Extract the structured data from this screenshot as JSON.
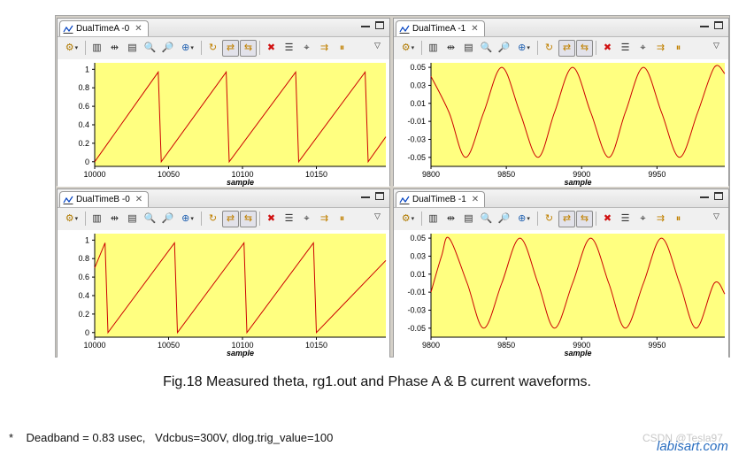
{
  "panels": [
    {
      "tab_label": "DualTimeA -0",
      "chart_data": {
        "type": "line",
        "xlabel": "sample",
        "ylabel": "",
        "xlim": [
          10000,
          10197
        ],
        "ylim": [
          -0.05,
          1.07
        ],
        "x_ticks": [
          10000,
          10050,
          10100,
          10150
        ],
        "y_ticks": [
          0,
          0.2,
          0.4,
          0.6,
          0.8,
          1
        ],
        "y_tick_labels": [
          "0",
          "0.2",
          "0.4",
          "0.6",
          "0.8",
          "1"
        ],
        "series": [
          {
            "color": "#cc0000",
            "points": [
              [
                10000,
                0.0
              ],
              [
                10043,
                0.97
              ],
              [
                10045,
                0.0
              ],
              [
                10089,
                0.97
              ],
              [
                10091,
                0.0
              ],
              [
                10136,
                0.97
              ],
              [
                10138,
                0.0
              ],
              [
                10183,
                0.97
              ],
              [
                10185,
                0.0
              ],
              [
                10197,
                0.27
              ]
            ]
          }
        ]
      }
    },
    {
      "tab_label": "DualTimeA -1",
      "chart_data": {
        "type": "line",
        "xlabel": "sample",
        "ylabel": "",
        "xlim": [
          9800,
          9995
        ],
        "ylim": [
          -0.06,
          0.055
        ],
        "x_ticks": [
          9800,
          9850,
          9900,
          9950
        ],
        "y_ticks": [
          -0.05,
          -0.03,
          -0.01,
          0.01,
          0.03,
          0.05
        ],
        "y_tick_labels": [
          "-0.05",
          "-0.03",
          "-0.01",
          "0.01",
          "0.03",
          "0.05"
        ],
        "series": [
          {
            "color": "#cc0000",
            "points": [
              [
                9800,
                0.04
              ],
              [
                9812,
                0.0
              ],
              [
                9823,
                -0.05
              ],
              [
                9835,
                0.0
              ],
              [
                9847,
                0.05
              ],
              [
                9859,
                0.0
              ],
              [
                9871,
                -0.05
              ],
              [
                9882,
                0.0
              ],
              [
                9894,
                0.05
              ],
              [
                9906,
                0.0
              ],
              [
                9918,
                -0.05
              ],
              [
                9929,
                0.0
              ],
              [
                9941,
                0.05
              ],
              [
                9953,
                0.0
              ],
              [
                9965,
                -0.05
              ],
              [
                9977,
                0.0
              ],
              [
                9988,
                0.05
              ],
              [
                9995,
                0.043
              ]
            ]
          }
        ]
      }
    },
    {
      "tab_label": "DualTimeB -0",
      "chart_data": {
        "type": "line",
        "xlabel": "sample",
        "ylabel": "",
        "xlim": [
          10000,
          10197
        ],
        "ylim": [
          -0.05,
          1.07
        ],
        "x_ticks": [
          10000,
          10050,
          10100,
          10150
        ],
        "y_ticks": [
          0,
          0.2,
          0.4,
          0.6,
          0.8,
          1
        ],
        "y_tick_labels": [
          "0",
          "0.2",
          "0.4",
          "0.6",
          "0.8",
          "1"
        ],
        "series": [
          {
            "color": "#cc0000",
            "points": [
              [
                10000,
                0.7
              ],
              [
                10007,
                0.97
              ],
              [
                10009,
                0.0
              ],
              [
                10054,
                0.97
              ],
              [
                10056,
                0.0
              ],
              [
                10101,
                0.97
              ],
              [
                10103,
                0.0
              ],
              [
                10148,
                0.97
              ],
              [
                10150,
                0.0
              ],
              [
                10197,
                0.78
              ]
            ]
          }
        ]
      }
    },
    {
      "tab_label": "DualTimeB -1",
      "chart_data": {
        "type": "line",
        "xlabel": "sample",
        "ylabel": "",
        "xlim": [
          9800,
          9995
        ],
        "ylim": [
          -0.06,
          0.055
        ],
        "x_ticks": [
          9800,
          9850,
          9900,
          9950
        ],
        "y_ticks": [
          -0.05,
          -0.03,
          -0.01,
          0.01,
          0.03,
          0.05
        ],
        "y_tick_labels": [
          "-0.05",
          "-0.03",
          "-0.01",
          "0.01",
          "0.03",
          "0.05"
        ],
        "series": [
          {
            "color": "#cc0000",
            "points": [
              [
                9800,
                -0.01
              ],
              [
                9807,
                0.03
              ],
              [
                9812,
                0.05
              ],
              [
                9824,
                0.0
              ],
              [
                9835,
                -0.05
              ],
              [
                9847,
                0.0
              ],
              [
                9859,
                0.05
              ],
              [
                9871,
                0.0
              ],
              [
                9882,
                -0.05
              ],
              [
                9894,
                0.0
              ],
              [
                9906,
                0.05
              ],
              [
                9918,
                0.0
              ],
              [
                9929,
                -0.05
              ],
              [
                9941,
                0.0
              ],
              [
                9953,
                0.05
              ],
              [
                9965,
                0.0
              ],
              [
                9976,
                -0.05
              ],
              [
                9988,
                0.0
              ],
              [
                9995,
                -0.012
              ]
            ]
          }
        ]
      }
    }
  ],
  "toolbar_icons": [
    "options-icon",
    "columns-icon",
    "align-icon",
    "table-icon",
    "zoom-in-icon",
    "zoom-out-icon",
    "zoom-window-icon",
    "refresh-icon",
    "sync-icon",
    "sync-alt-icon",
    "delete-icon",
    "list-icon",
    "binoculars-icon",
    "step-icon",
    "pause-icon"
  ],
  "plot_background": "#ffff80",
  "caption": "Fig.18 Measured theta, rg1.out and Phase A & B current waveforms.",
  "note": "*    Deadband = 0.83 usec,   Vdcbus=300V, dlog.trig_value=100",
  "watermark_csdn": "CSDN @Tesla97",
  "watermark_site": "labisart.com"
}
